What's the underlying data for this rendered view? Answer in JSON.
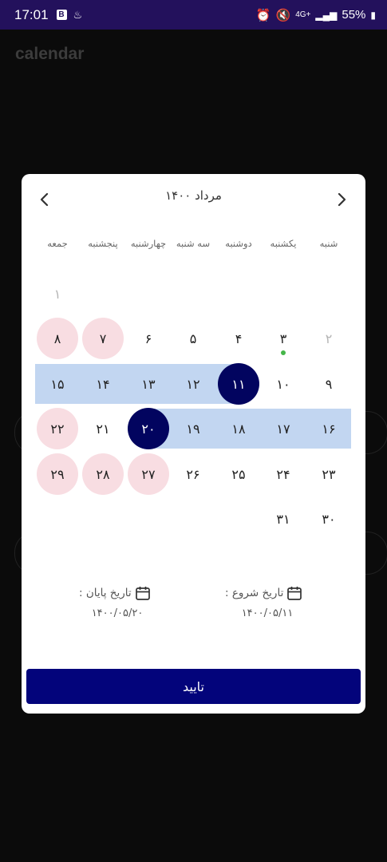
{
  "status_bar": {
    "time": "17:01",
    "badge": "B",
    "network": "4G+",
    "battery": "55%"
  },
  "app": {
    "title": "calendar"
  },
  "dialog": {
    "month_title": "مرداد ۱۴۰۰",
    "weekdays": [
      "شنبه",
      "یکشنبه",
      "دوشنبه",
      "سه شنبه",
      "چهارشنبه",
      "پنجشنبه",
      "جمعه"
    ],
    "days": {
      "d1": "۱",
      "d2": "۲",
      "d3": "۳",
      "d4": "۴",
      "d5": "۵",
      "d6": "۶",
      "d7": "۷",
      "d8": "۸",
      "d9": "۹",
      "d10": "۱۰",
      "d11": "۱۱",
      "d12": "۱۲",
      "d13": "۱۳",
      "d14": "۱۴",
      "d15": "۱۵",
      "d16": "۱۶",
      "d17": "۱۷",
      "d18": "۱۸",
      "d19": "۱۹",
      "d20": "۲۰",
      "d21": "۲۱",
      "d22": "۲۲",
      "d23": "۲۳",
      "d24": "۲۴",
      "d25": "۲۵",
      "d26": "۲۶",
      "d27": "۲۷",
      "d28": "۲۸",
      "d29": "۲۹",
      "d30": "۳۰",
      "d31": "۳۱"
    },
    "start_date": {
      "label": "تاریخ شروع :",
      "value": "۱۴۰۰/۰۵/۱۱"
    },
    "end_date": {
      "label": "تاریخ پایان :",
      "value": "۱۴۰۰/۰۵/۲۰"
    },
    "confirm_label": "تایید"
  },
  "colors": {
    "status_bar": "#23115c",
    "selected_day": "#02045f",
    "range_band": "#c2d6f1",
    "weekend_circle": "#f8dde2",
    "today_dot": "#45b649",
    "confirm_button": "#03047b"
  }
}
